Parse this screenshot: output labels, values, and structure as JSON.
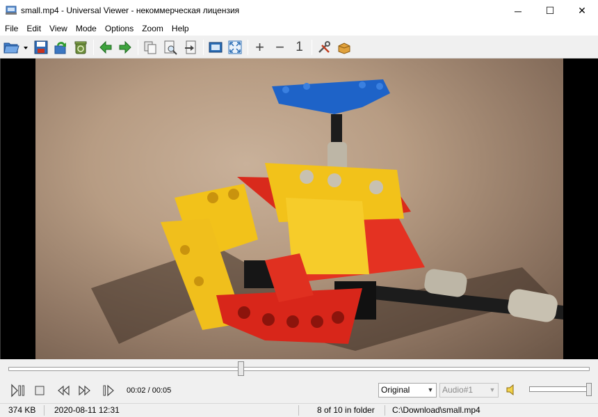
{
  "window": {
    "title": "small.mp4 - Universal Viewer - некоммерческая лицензия",
    "minimize_glyph": "─",
    "maximize_glyph": "☐",
    "close_glyph": "✕"
  },
  "menu": {
    "items": [
      "File",
      "Edit",
      "View",
      "Mode",
      "Options",
      "Zoom",
      "Help"
    ]
  },
  "toolbar": {
    "buttons": [
      {
        "name": "open-icon"
      },
      {
        "name": "save-icon"
      },
      {
        "name": "reload-icon"
      },
      {
        "name": "recycle-icon"
      },
      {
        "name": "previous-file-icon"
      },
      {
        "name": "next-file-icon"
      },
      {
        "name": "copy-icon"
      },
      {
        "name": "find-icon"
      },
      {
        "name": "export-icon"
      },
      {
        "name": "fit-window-icon"
      },
      {
        "name": "fullscreen-icon"
      },
      {
        "name": "zoom-in-icon"
      },
      {
        "name": "zoom-out-icon"
      },
      {
        "name": "original-size-icon"
      },
      {
        "name": "settings-icon"
      },
      {
        "name": "plugins-icon"
      }
    ],
    "zoom_in_glyph": "+",
    "zoom_out_glyph": "−",
    "original_size_glyph": "1"
  },
  "player": {
    "position_fraction": 0.4,
    "time": "00:02 / 00:05",
    "zoom_mode": "Original",
    "audio_track": "Audio#1",
    "volume_fraction": 1.0
  },
  "status": {
    "file_size": "374 KB",
    "modified": "2020-08-11 12:31",
    "position_in_folder": "8 of 10 in folder",
    "path": "C:\\Download\\small.mp4"
  },
  "colors": {
    "accent_green": "#3ea33e",
    "toolbar_blue": "#2a6db5"
  }
}
